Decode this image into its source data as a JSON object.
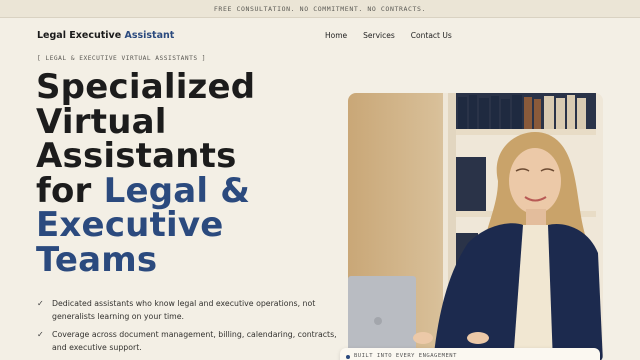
{
  "topbar": {
    "text": "FREE CONSULTATION. NO COMMITMENT. NO CONTRACTS."
  },
  "brand": {
    "name_part1": "Legal Executive",
    "name_part2": "Assistant"
  },
  "nav": {
    "items": [
      "Home",
      "Services",
      "Contact Us"
    ]
  },
  "hero": {
    "eyebrow": "[ LEGAL & EXECUTIVE VIRTUAL ASSISTANTS ]",
    "headline_lines": [
      "Specialized",
      "Virtual",
      "Assistants",
      "for"
    ],
    "headline_accent_inline": "Legal &",
    "headline_accent_lines": [
      "Executive",
      "Teams"
    ],
    "bullets": [
      "Dedicated assistants who know legal and executive operations, not generalists learning on your time.",
      "Coverage across document management, billing, calendaring, contracts, and executive support."
    ]
  },
  "badge": {
    "text": "BUILT INTO EVERY ENGAGEMENT"
  },
  "colors": {
    "accent": "#2b4a7e",
    "background": "#f3efe5",
    "topbar": "#ebe5d6"
  }
}
